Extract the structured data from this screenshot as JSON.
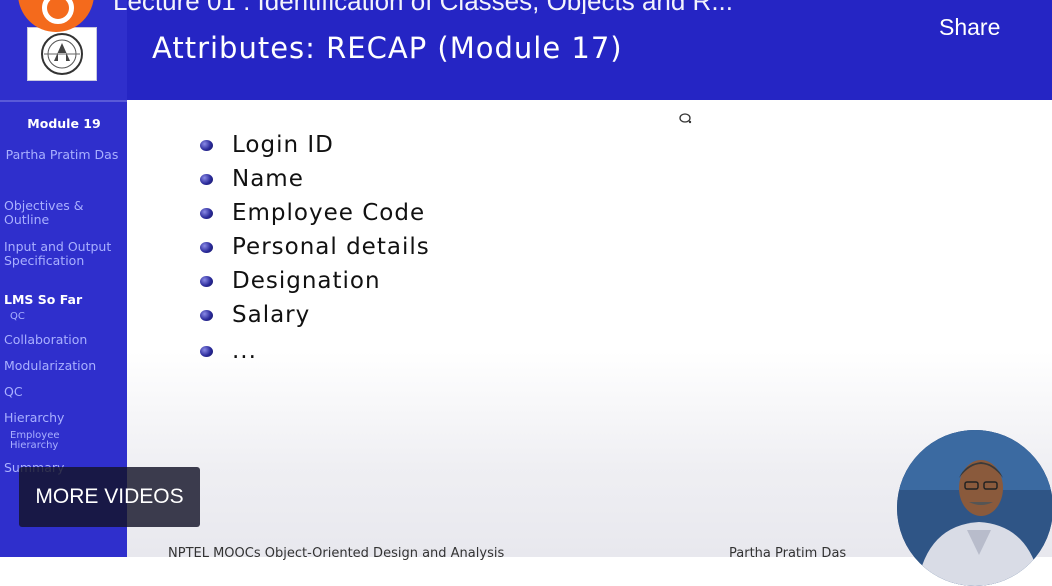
{
  "video": {
    "title": "Lecture 01 : Identification of Classes, Objects and R...",
    "share_label": "Share",
    "more_videos_label": "MORE VIDEOS"
  },
  "slide": {
    "title": "Attributes: RECAP (Module 17)",
    "bullets": [
      "Login ID",
      "Name",
      "Employee Code",
      "Personal details",
      "Designation",
      "Salary",
      "..."
    ],
    "footer_left": "NPTEL MOOCs Object-Oriented Design and Analysis",
    "footer_right": "Partha Pratim Das"
  },
  "sidebar": {
    "module": "Module 19",
    "author": "Partha Pratim Das",
    "items": [
      {
        "label": "Objectives & Outline"
      },
      {
        "label": "Input and Output Specification"
      },
      {
        "label": "LMS So Far"
      },
      {
        "label": "QC"
      },
      {
        "label": "Collaboration"
      },
      {
        "label": "Modularization"
      },
      {
        "label": "QC"
      },
      {
        "label": "Hierarchy"
      },
      {
        "label": "Employee Hierarchy"
      },
      {
        "label": "Summary"
      }
    ]
  },
  "colors": {
    "header": "#2525c4",
    "sidebar": "#2f2fcc",
    "sidebar_text": "#a9b0ff",
    "channel_avatar": "#f46a1c"
  },
  "icons": {
    "logo": "iit-kharagpur-logo-icon",
    "cursor": "cursor-icon"
  }
}
